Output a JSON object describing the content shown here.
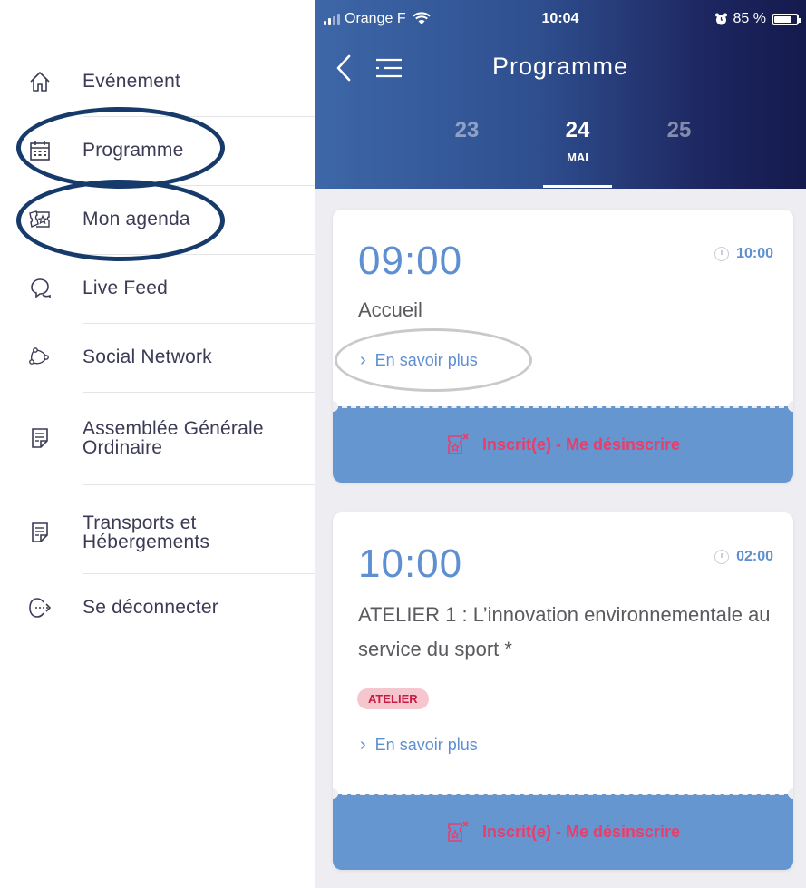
{
  "sidebar": {
    "items": [
      {
        "label": "Evénement",
        "icon": "home-icon"
      },
      {
        "label": "Programme",
        "icon": "calendar-icon"
      },
      {
        "label": "Mon agenda",
        "icon": "tickets-icon"
      },
      {
        "label": "Live Feed",
        "icon": "chat-bubbles-icon"
      },
      {
        "label": "Social Network",
        "icon": "network-icon"
      },
      {
        "label": "Assemblée Générale Ordinaire",
        "icon": "document-icon"
      },
      {
        "label": "Transports et Hébergements",
        "icon": "document-icon"
      },
      {
        "label": "Se déconnecter",
        "icon": "logout-icon"
      }
    ],
    "annotation_color": "#163b6b"
  },
  "status_bar": {
    "carrier": "Orange F",
    "time": "10:04",
    "battery": "85 %",
    "battery_level": 0.85
  },
  "header": {
    "title": "Programme",
    "days": [
      {
        "num": "23",
        "month": ""
      },
      {
        "num": "24",
        "month": "MAI"
      },
      {
        "num": "25",
        "month": ""
      }
    ],
    "active_day_index": 1,
    "gradient": [
      "#3d67a8",
      "#141a4d"
    ]
  },
  "events": [
    {
      "start": "09:00",
      "duration": "10:00",
      "title": "Accueil",
      "tag": "",
      "more_label": "En savoir plus",
      "action_label": "Inscrit(e) - Me désinscrire"
    },
    {
      "start": "10:00",
      "duration": "02:00",
      "title": "ATELIER 1 : L’innovation environnementale au service du sport *",
      "tag": "ATELIER",
      "more_label": "En savoir plus",
      "action_label": "Inscrit(e) - Me désinscrire"
    }
  ],
  "colors": {
    "accent": "#5e8fd1",
    "action_bg": "#6596d0",
    "action_text": "#e83e6c",
    "tag_bg": "#f6c6ce",
    "tag_text": "#c71d44"
  }
}
